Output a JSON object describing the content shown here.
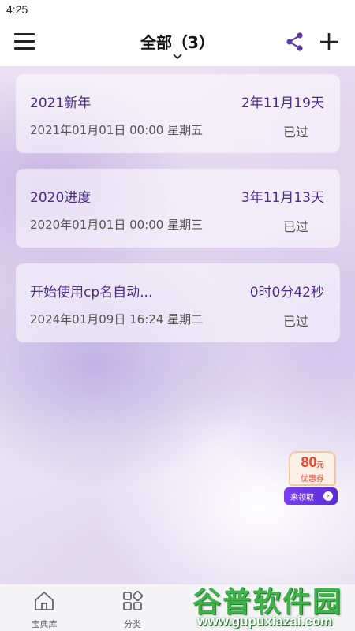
{
  "status_bar": {
    "time": "4:25"
  },
  "app_bar": {
    "title": "全部",
    "count": "（3）"
  },
  "events": [
    {
      "name": "2021新年",
      "duration": "2年11月19天",
      "date": "2021年01月01日 00:00 星期五",
      "status": "已过"
    },
    {
      "name": "2020进度",
      "duration": "3年11月13天",
      "date": "2020年01月01日 00:00 星期三",
      "status": "已过"
    },
    {
      "name": "开始使用cp名自动...",
      "duration": "0时0分42秒",
      "date": "2024年01月09日 16:24 星期二",
      "status": "已过"
    }
  ],
  "coupon": {
    "amount": "80",
    "unit": "元",
    "label": "优惠券",
    "action": "来领取"
  },
  "bottom_nav": [
    {
      "label": "宝典库",
      "icon": "home-icon"
    },
    {
      "label": "分类",
      "icon": "grid-icon"
    }
  ],
  "watermark": {
    "title": "谷普软件园",
    "url": "www.gupuxiazai.com"
  },
  "colors": {
    "accent": "#4a2d8a",
    "share_icon": "#5b3aa6"
  }
}
